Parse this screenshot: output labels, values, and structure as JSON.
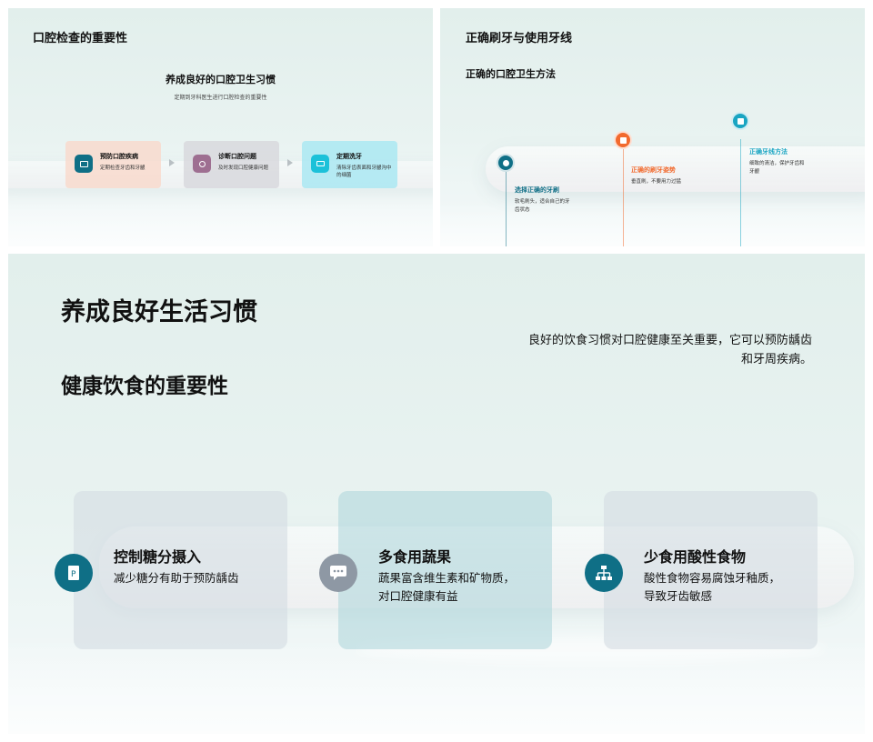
{
  "slide1": {
    "title": "口腔检查的重要性",
    "heading": "养成良好的口腔卫生习惯",
    "subheading": "定期到牙科医生进行口腔检查的重要性",
    "steps": [
      {
        "title": "预防口腔疾病",
        "desc": "定期检查牙齿和牙龈",
        "icon": "image-icon",
        "color": "#0f6f86"
      },
      {
        "title": "诊断口腔问题",
        "desc": "及时发现口腔健康问题",
        "icon": "target-icon",
        "color": "#9e6f91"
      },
      {
        "title": "定期洗牙",
        "desc": "清除牙齿表面和牙龈沟中的细菌",
        "icon": "chat-icon",
        "color": "#1cc1d9"
      }
    ]
  },
  "slide2": {
    "title": "正确刷牙与使用牙线",
    "subtitle": "正确的口腔卫生方法",
    "points": [
      {
        "title": "选择正确的牙刷",
        "desc": "软毛刷头，适合自己的牙齿状态",
        "icon": "target-icon",
        "color": "#0f6f86"
      },
      {
        "title": "正确的刷牙姿势",
        "desc": "垂直刷，不要用力过猛",
        "icon": "org-chart-icon",
        "color": "#f26a2e"
      },
      {
        "title": "正确牙线方法",
        "desc": "细致的清洁，保护牙齿和牙龈",
        "icon": "image-icon",
        "color": "#1aa5c2"
      }
    ]
  },
  "slide3": {
    "title": "养成良好生活习惯",
    "subtitle": "健康饮食的重要性",
    "description": "良好的饮食习惯对口腔健康至关重要，它可以预防龋齿和牙周疾病。",
    "cards": [
      {
        "title": "控制糖分摄入",
        "desc": "减少糖分有助于预防龋齿",
        "icon": "document-icon",
        "color": "#0f6f86"
      },
      {
        "title": "多食用蔬果",
        "desc": "蔬果富含维生素和矿物质，对口腔健康有益",
        "icon": "chat-icon",
        "color": "#8e98a4"
      },
      {
        "title": "少食用酸性食物",
        "desc": "酸性食物容易腐蚀牙釉质，导致牙齿敏感",
        "icon": "org-chart-icon",
        "color": "#0f6f86"
      }
    ]
  }
}
